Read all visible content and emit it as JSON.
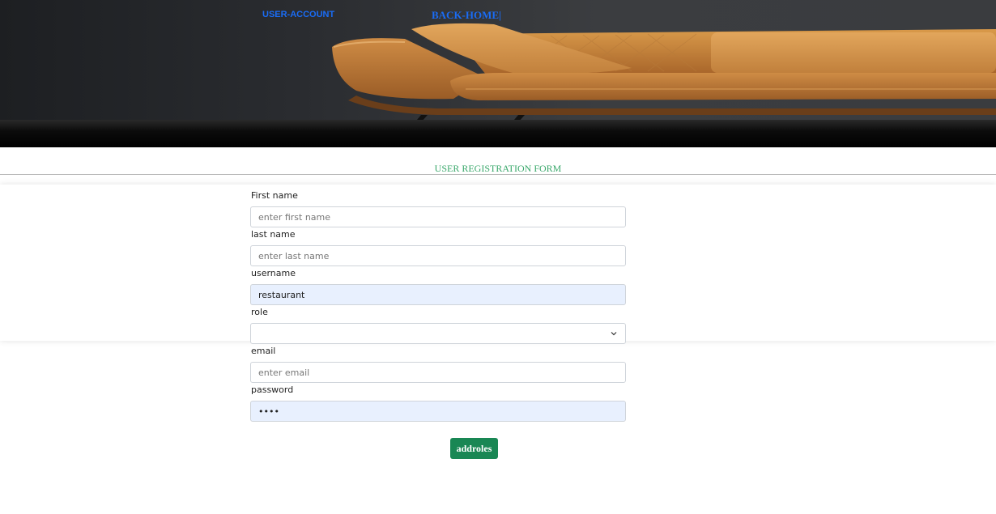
{
  "nav": {
    "account_label": "USER-ACCOUNT",
    "home_label": "BACK-HOME|"
  },
  "hero": {
    "image": "leather-sofa-banner"
  },
  "form": {
    "title": "USER REGISTRATION FORM",
    "first_name": {
      "label": "First name",
      "placeholder": "enter first name",
      "value": ""
    },
    "last_name": {
      "label": "last name",
      "placeholder": "enter last name",
      "value": ""
    },
    "username": {
      "label": "username",
      "value": "restaurant"
    },
    "role": {
      "label": "role",
      "value": ""
    },
    "email": {
      "label": "email",
      "placeholder": "enter email",
      "value": ""
    },
    "password": {
      "label": "password",
      "value": "••••"
    },
    "submit_label": "addroles"
  },
  "colors": {
    "link": "#1a6cf5",
    "title": "#3aa86b",
    "button": "#198754",
    "autofill": "#e8f0fe"
  }
}
